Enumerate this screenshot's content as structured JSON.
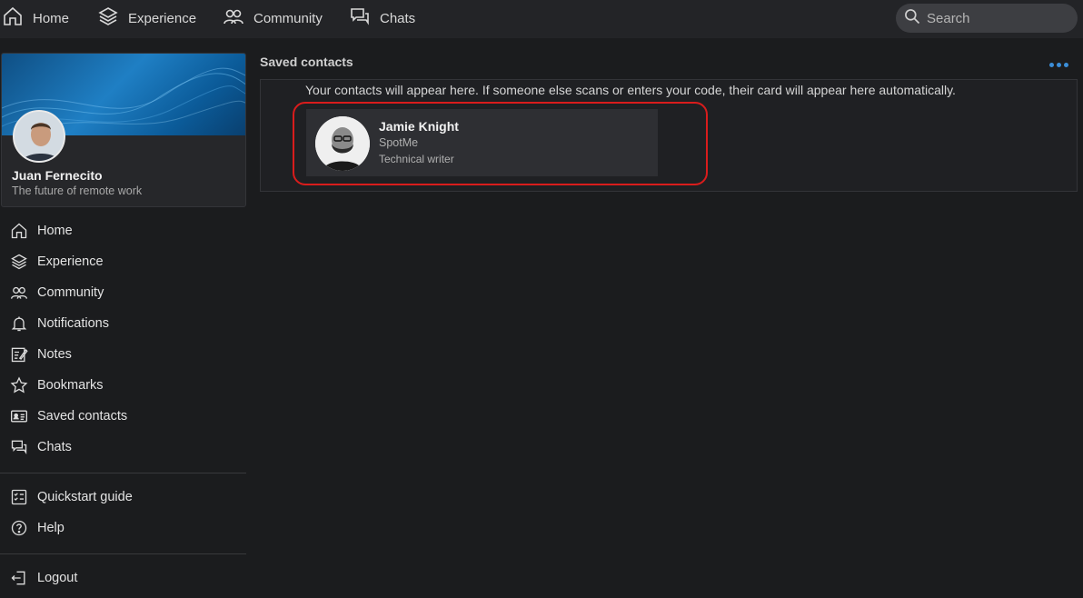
{
  "topnav": {
    "items": [
      {
        "label": "Home",
        "icon": "home-icon"
      },
      {
        "label": "Experience",
        "icon": "layers-icon"
      },
      {
        "label": "Community",
        "icon": "people-icon"
      },
      {
        "label": "Chats",
        "icon": "chat-icon"
      }
    ],
    "search_placeholder": "Search"
  },
  "profile": {
    "name": "Juan Fernecito",
    "tagline": "The future of remote work"
  },
  "sidebar": {
    "items": [
      {
        "label": "Home",
        "icon": "home-icon"
      },
      {
        "label": "Experience",
        "icon": "layers-icon"
      },
      {
        "label": "Community",
        "icon": "people-icon"
      },
      {
        "label": "Notifications",
        "icon": "bell-icon"
      },
      {
        "label": "Notes",
        "icon": "notes-icon"
      },
      {
        "label": "Bookmarks",
        "icon": "star-icon"
      },
      {
        "label": "Saved contacts",
        "icon": "contact-card-icon"
      },
      {
        "label": "Chats",
        "icon": "chat-icon"
      }
    ],
    "secondary": [
      {
        "label": "Quickstart guide",
        "icon": "checklist-icon"
      },
      {
        "label": "Help",
        "icon": "help-icon"
      }
    ],
    "logout": {
      "label": "Logout",
      "icon": "logout-icon"
    }
  },
  "main": {
    "title": "Saved contacts",
    "info": "Your contacts will appear here. If someone else scans or enters your code, their card will appear here automatically.",
    "contacts": [
      {
        "name": "Jamie Knight",
        "company": "SpotMe",
        "role": "Technical writer"
      }
    ]
  },
  "colors": {
    "accent": "#3b8ed8",
    "highlight": "#d91c1c",
    "background": "#1b1c1e"
  }
}
